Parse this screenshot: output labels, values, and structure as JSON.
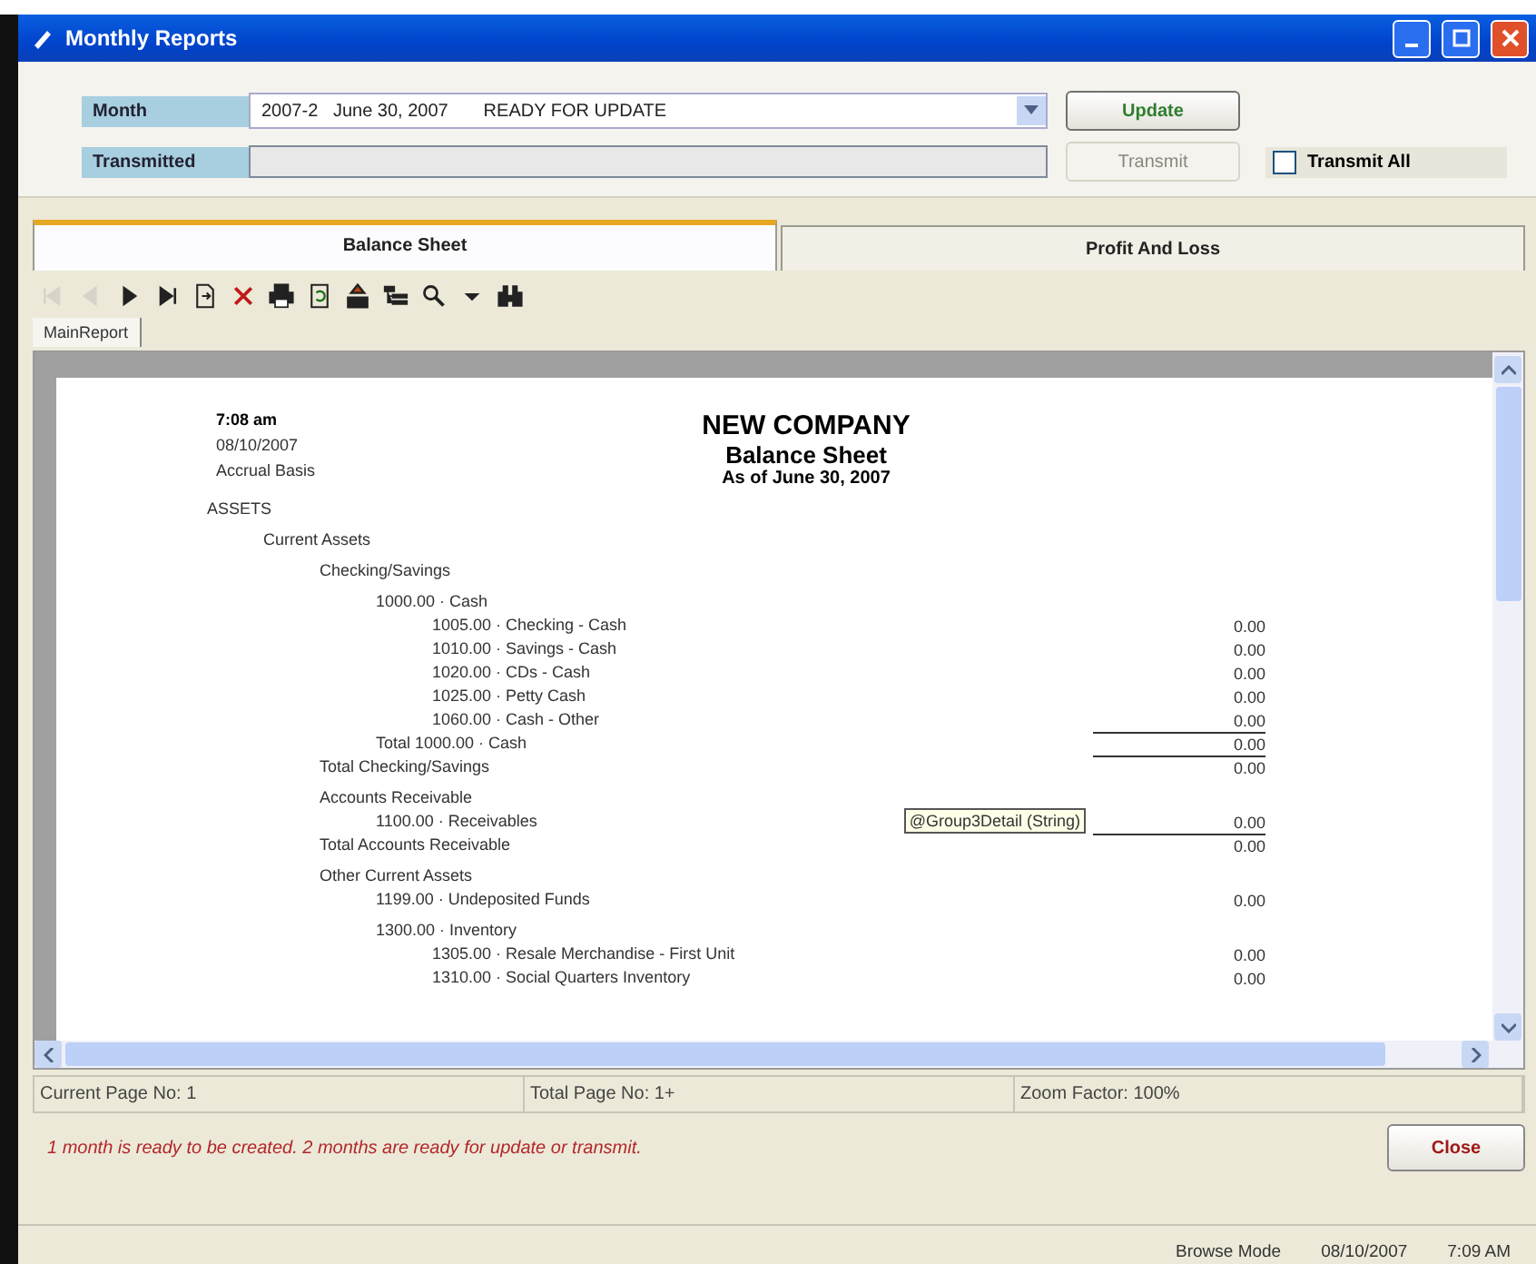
{
  "window": {
    "title": "Monthly Reports"
  },
  "form": {
    "month_label": "Month",
    "month_value": "2007-2   June 30, 2007       READY FOR UPDATE",
    "transmitted_label": "Transmitted",
    "update_button": {
      "label": "Update",
      "disabled": false
    },
    "transmit_button": {
      "label": "Transmit",
      "disabled": true
    },
    "transmit_all": {
      "label": "Transmit All",
      "checked": false
    }
  },
  "tabs": [
    {
      "label": "Balance Sheet",
      "selected": true
    },
    {
      "label": "Profit And Loss",
      "selected": false
    }
  ],
  "toolbar": [
    {
      "kind": "first",
      "disabled": true
    },
    {
      "kind": "prev",
      "disabled": true
    },
    {
      "kind": "next",
      "disabled": false
    },
    {
      "kind": "last",
      "disabled": false
    },
    {
      "kind": "export",
      "disabled": false
    },
    {
      "kind": "close",
      "disabled": false
    },
    {
      "kind": "print",
      "disabled": false
    },
    {
      "kind": "refresh",
      "disabled": false
    },
    {
      "kind": "upload",
      "disabled": false
    },
    {
      "kind": "tree",
      "disabled": false
    },
    {
      "kind": "zoom",
      "disabled": false
    },
    {
      "kind": "dropdown",
      "disabled": false
    },
    {
      "kind": "find",
      "disabled": false
    }
  ],
  "report_tab": "MainReport",
  "report": {
    "time": "7:08 am",
    "date": "08/10/2007",
    "basis": "Accrual Basis",
    "company": "NEW COMPANY",
    "title": "Balance Sheet",
    "subtitle": "As of June 30, 2007",
    "lines": [
      {
        "label": "ASSETS",
        "children": [
          {
            "label": "Current Assets",
            "children": [
              {
                "label": "Checking/Savings",
                "children": [
                  {
                    "label": "1000.00 · Cash",
                    "children": [
                      {
                        "label": "1005.00 · Checking - Cash",
                        "amount": "0.00"
                      },
                      {
                        "label": "1010.00 · Savings - Cash",
                        "amount": "0.00"
                      },
                      {
                        "label": "1020.00 · CDs - Cash",
                        "amount": "0.00"
                      },
                      {
                        "label": "1025.00 · Petty Cash",
                        "amount": "0.00"
                      },
                      {
                        "label": "1060.00 · Cash - Other",
                        "amount": "0.00"
                      }
                    ]
                  },
                  {
                    "label": "Total 1000.00 · Cash",
                    "amount": "0.00",
                    "rule_above": true
                  }
                ]
              },
              {
                "label": "Total Checking/Savings",
                "amount": "0.00",
                "rule_above": true
              },
              {
                "label": "Accounts Receivable",
                "children": [
                  {
                    "label": "1100.00 · Receivables",
                    "amount": "0.00",
                    "tip": "@Group3Detail (String)"
                  }
                ]
              },
              {
                "label": "Total Accounts Receivable",
                "amount": "0.00",
                "rule_above": true
              },
              {
                "label": "Other Current Assets",
                "children": [
                  {
                    "label": "1199.00 · Undeposited Funds",
                    "amount": "0.00"
                  },
                  {
                    "label": "1300.00 · Inventory",
                    "children": [
                      {
                        "label": "1305.00 · Resale Merchandise - First Unit",
                        "amount": "0.00"
                      },
                      {
                        "label": "1310.00 · Social Quarters Inventory",
                        "amount": "0.00"
                      }
                    ]
                  }
                ]
              }
            ]
          }
        ]
      }
    ]
  },
  "page_status": [
    "Current Page No: 1",
    "Total Page No: 1+",
    "Zoom Factor: 100%"
  ],
  "message": "1 month is ready to be created.  2 months are ready for update or transmit.",
  "close_button": "Close",
  "status_bar": [
    "Browse Mode",
    "08/10/2007",
    "7:09 AM"
  ]
}
